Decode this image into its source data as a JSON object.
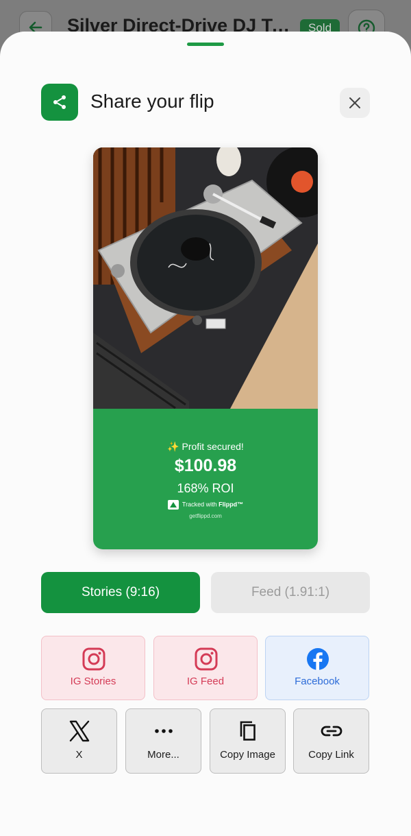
{
  "background": {
    "title": "Silver Direct-Drive DJ Turntable",
    "status_badge": "Sold"
  },
  "sheet": {
    "title": "Share your flip",
    "preview": {
      "profit_line": "✨ Profit secured!",
      "amount": "$100.98",
      "roi": "168% ROI",
      "tracked_prefix": "Tracked with ",
      "brand": "Flippd™",
      "site": "getflippd.com"
    },
    "formats": {
      "stories": "Stories (9:16)",
      "feed": "Feed (1.91:1)"
    },
    "social": {
      "ig_stories": "IG Stories",
      "ig_feed": "IG Feed",
      "facebook": "Facebook"
    },
    "actions": {
      "x": "X",
      "more": "More...",
      "copy_image": "Copy Image",
      "copy_link": "Copy Link"
    }
  },
  "colors": {
    "brand_green": "#14923f",
    "panel_green": "#27a04e",
    "instagram": "#d43b56",
    "facebook": "#1877f2"
  },
  "icons": [
    "back-arrow-icon",
    "help-icon",
    "share-icon",
    "close-icon",
    "instagram-icon",
    "facebook-icon",
    "x-logo-icon",
    "more-dots-icon",
    "copy-icon",
    "link-icon",
    "flippd-logo-icon"
  ]
}
